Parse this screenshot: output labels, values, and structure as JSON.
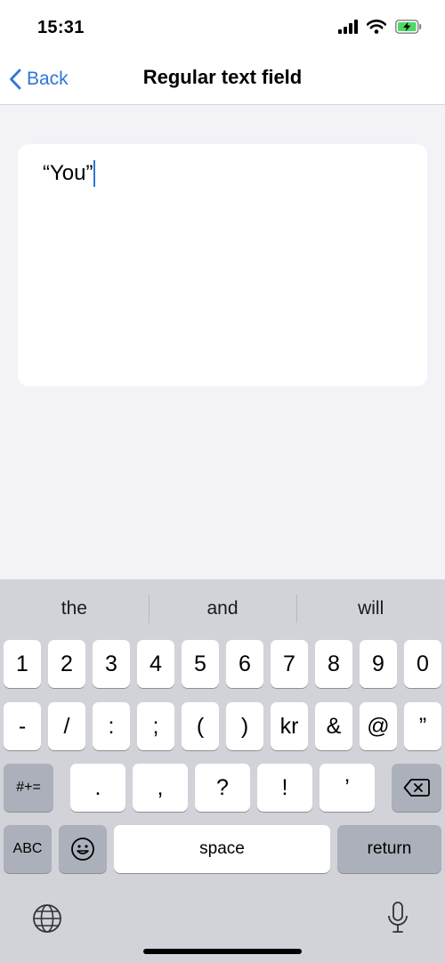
{
  "status_bar": {
    "time": "15:31"
  },
  "nav": {
    "back_label": "Back",
    "title": "Regular text field"
  },
  "text_field": {
    "value": "“You”"
  },
  "keyboard": {
    "suggestions": [
      "the",
      "and",
      "will"
    ],
    "row1": [
      "1",
      "2",
      "3",
      "4",
      "5",
      "6",
      "7",
      "8",
      "9",
      "0"
    ],
    "row2": [
      "-",
      "/",
      ":",
      ";",
      "(",
      ")",
      "kr",
      "&",
      "@",
      "”"
    ],
    "row3_left": "#+=",
    "row3": [
      ".",
      ",",
      "?",
      "!",
      "’"
    ],
    "abc_label": "ABC",
    "space_label": "space",
    "return_label": "return"
  },
  "icons": {
    "signal": "cellular-signal-icon",
    "wifi": "wifi-icon",
    "battery": "battery-charging-icon",
    "back": "chevron-left-icon",
    "emoji": "emoji-icon",
    "globe": "globe-icon",
    "mic": "microphone-icon",
    "delete": "delete-backspace-icon"
  },
  "colors": {
    "accent": "#2f76d9",
    "battery": "#4cd964"
  }
}
